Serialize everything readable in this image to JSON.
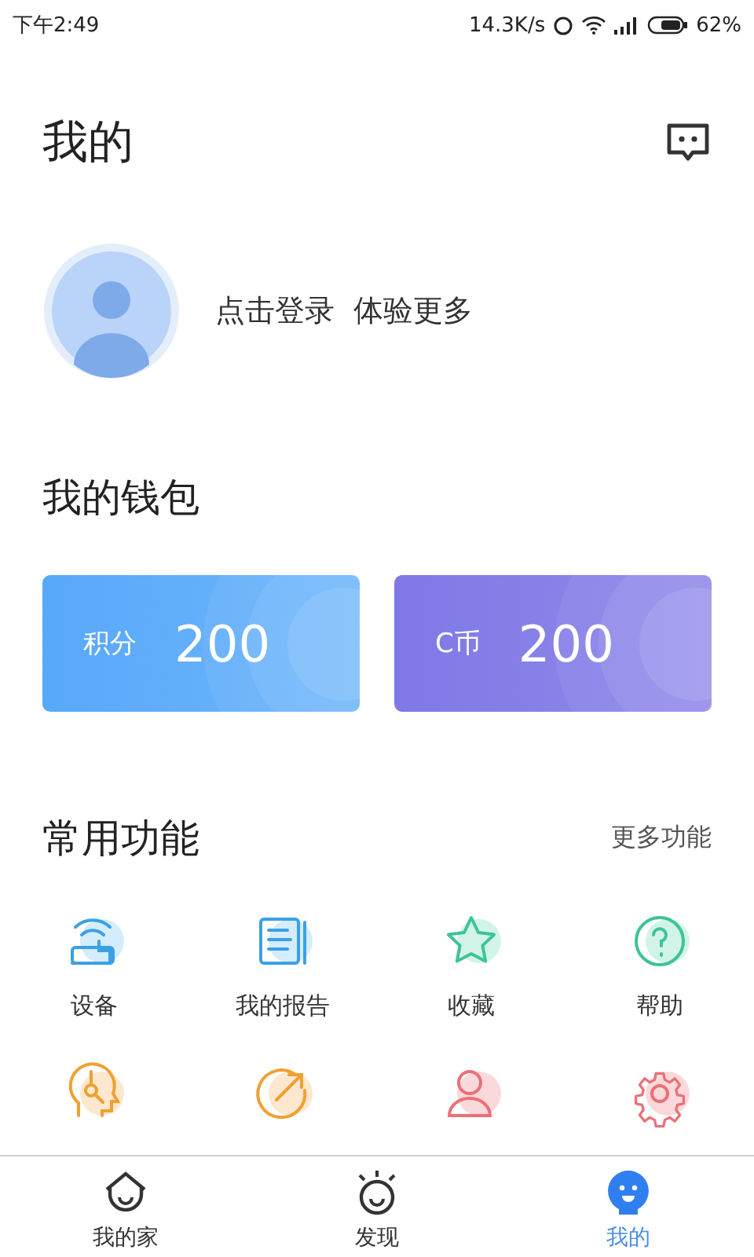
{
  "status_bar": {
    "time": "下午2:49",
    "speed": "14.3K/s",
    "battery": "62%"
  },
  "header": {
    "title": "我的"
  },
  "profile": {
    "login_text": "点击登录  体验更多"
  },
  "wallet": {
    "title": "我的钱包",
    "cards": [
      {
        "kind": "points",
        "label": "积分",
        "value": "200"
      },
      {
        "kind": "coins",
        "label": "C币",
        "value": "200"
      }
    ]
  },
  "features": {
    "title": "常用功能",
    "more": "更多功能",
    "items": [
      {
        "kind": "device",
        "label": "设备"
      },
      {
        "kind": "report",
        "label": "我的报告"
      },
      {
        "kind": "favorite",
        "label": "收藏"
      },
      {
        "kind": "help",
        "label": "帮助"
      },
      {
        "kind": "head"
      },
      {
        "kind": "share"
      },
      {
        "kind": "person"
      },
      {
        "kind": "gear"
      }
    ]
  },
  "tab_bar": [
    {
      "kind": "home",
      "label": "我的家",
      "selected": false
    },
    {
      "kind": "discover",
      "label": "发现",
      "selected": false
    },
    {
      "kind": "me",
      "label": "我的",
      "selected": true
    }
  ]
}
